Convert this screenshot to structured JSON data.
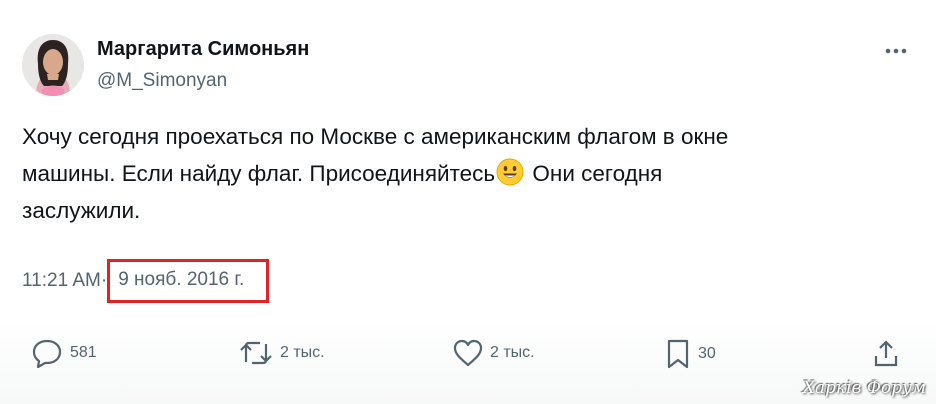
{
  "author": {
    "display_name": "Маргарита Симоньян",
    "handle": "@M_Simonyan",
    "avatar_icon": "profile-photo-icon"
  },
  "tweet": {
    "lines": [
      "Хочу сегодня проехаться по Москве с американским флагом в окне",
      "машины. Если найду флаг. Присоединяйтесь",
      "заслужили."
    ],
    "line2_after_emoji": "Они сегодня",
    "emoji": "smiling-face-emoji"
  },
  "meta": {
    "time": "11:21 AM",
    "separator": "·",
    "date": "9 нояб. 2016 г.",
    "highlight_color": "#e02424"
  },
  "actions": {
    "replies": "581",
    "retweets": "2 тыс.",
    "likes": "2 тыс.",
    "bookmarks": "30"
  },
  "watermark": "Харків Форум",
  "colors": {
    "text": "#0f1419",
    "secondary": "#536471"
  }
}
